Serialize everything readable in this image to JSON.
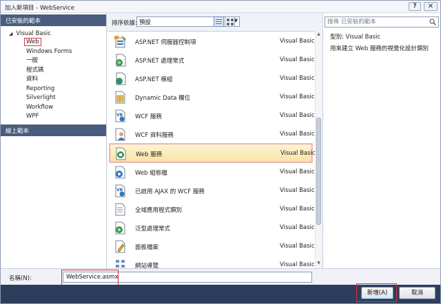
{
  "window": {
    "title": "加入新項目 - WebService",
    "help": "?",
    "close": "✕"
  },
  "left": {
    "installed_header": "已安裝的範本",
    "root": "Visual Basic",
    "items": [
      "Web",
      "Windows Forms",
      "一般",
      "程式碼",
      "資料",
      "Reporting",
      "Silverlight",
      "Workflow",
      "WPF"
    ],
    "online_header": "線上範本"
  },
  "toolbar": {
    "sort_label": "排序依據:",
    "sort_value": "預設"
  },
  "templates": [
    {
      "name": "ASP.NET 伺服器控制項",
      "lang": "Visual Basic",
      "icon": "server-control-icon"
    },
    {
      "name": "ASP.NET 處理常式",
      "lang": "Visual Basic",
      "icon": "handler-icon"
    },
    {
      "name": "ASP.NET 模組",
      "lang": "Visual Basic",
      "icon": "module-icon"
    },
    {
      "name": "Dynamic Data 欄位",
      "lang": "Visual Basic",
      "icon": "dynamic-data-icon"
    },
    {
      "name": "WCF 服務",
      "lang": "Visual Basic",
      "icon": "wcf-icon"
    },
    {
      "name": "WCF 資料服務",
      "lang": "Visual Basic",
      "icon": "wcf-data-icon"
    },
    {
      "name": "Web 服務",
      "lang": "Visual Basic",
      "icon": "web-service-icon"
    },
    {
      "name": "Web 組態檔",
      "lang": "Visual Basic",
      "icon": "config-icon"
    },
    {
      "name": "已啟用 AJAX 的 WCF 服務",
      "lang": "Visual Basic",
      "icon": "ajax-wcf-icon"
    },
    {
      "name": "全域應用程式類別",
      "lang": "Visual Basic",
      "icon": "global-icon"
    },
    {
      "name": "泛型處理常式",
      "lang": "Visual Basic",
      "icon": "generic-handler-icon"
    },
    {
      "name": "面板檔案",
      "lang": "Visual Basic",
      "icon": "skin-icon"
    },
    {
      "name": "網站導覽",
      "lang": "Visual Basic",
      "icon": "sitemap-icon"
    }
  ],
  "right": {
    "search_placeholder": "搜尋 已安裝的範本",
    "type_label": "型別:",
    "type_value": "Visual Basic",
    "description": "用來建立 Web 服務的視覺化設計類別"
  },
  "bottom": {
    "name_label": "名稱(N):",
    "name_value": "WebService.asmx",
    "ok": "新增(A)",
    "cancel": "取消"
  },
  "colors": {
    "header_bg": "#4a5d7e",
    "button_bar": "#2d3e5c",
    "highlight": "#e0303c",
    "selected_row": "#f8e4a6"
  }
}
